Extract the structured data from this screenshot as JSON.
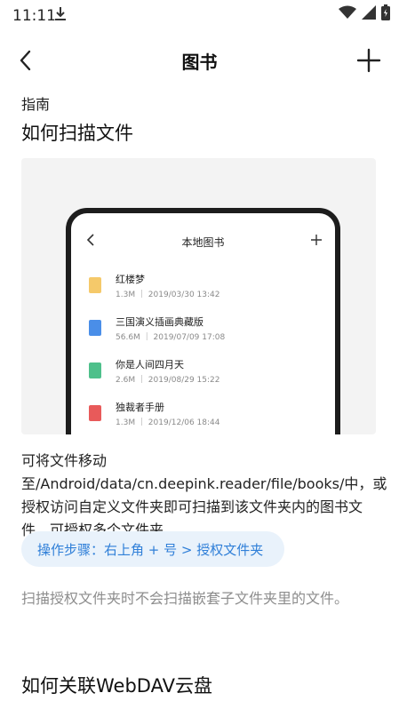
{
  "status_bar": {
    "time": "11:11"
  },
  "header": {
    "title": "图书"
  },
  "guide": {
    "label": "指南",
    "heading": "如何扫描文件",
    "description": "可将文件移动至/Android/data/cn.deepink.reader/file/books/中，或授权访问自定义文件夹即可扫描到该文件夹内的图书文件，可授权多个文件夹。",
    "step": "操作步骤：右上角 + 号 > 授权文件夹",
    "note": "扫描授权文件夹时不会扫描嵌套子文件夹里的文件。",
    "next_heading": "如何关联WebDAV云盘"
  },
  "preview": {
    "title": "本地图书",
    "books": [
      {
        "name": "红楼梦",
        "meta": "1.3M ｜ 2019/03/30 13:42",
        "icon_color": "#f5c96a"
      },
      {
        "name": "三国演义插画典藏版",
        "meta": "56.6M ｜ 2019/07/09 17:08",
        "icon_color": "#4a8ee8"
      },
      {
        "name": "你是人间四月天",
        "meta": "2.6M ｜ 2019/08/29 15:22",
        "icon_color": "#4ec08b"
      },
      {
        "name": "独裁者手册",
        "meta": "1.3M ｜ 2019/12/06 18:44",
        "icon_color": "#e85a5a"
      }
    ]
  },
  "icons": {
    "download": "download-icon",
    "wifi": "wifi-icon",
    "signal": "signal-icon",
    "battery": "battery-icon",
    "back": "back-arrow-icon",
    "add": "plus-icon"
  }
}
